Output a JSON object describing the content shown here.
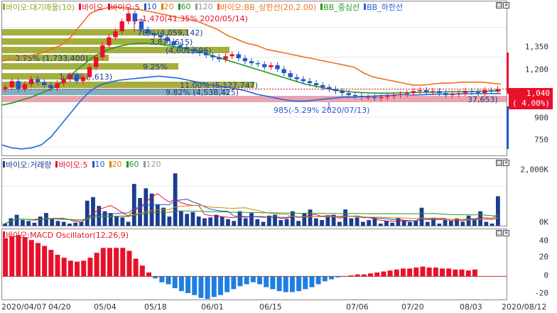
{
  "price_panel": {
    "legend": [
      {
        "label": "바이오:대기매물(10)",
        "color": "#9aa62a"
      },
      {
        "label": "바이오",
        "color": "#e8102a"
      },
      {
        "label": "바이오:5",
        "color": "#e8102a",
        "extra": [
          "10",
          "20",
          "60",
          "120"
        ],
        "extra_colors": [
          "#2255cc",
          "#e08000",
          "#229922",
          "#999999"
        ]
      },
      {
        "label": "바이오:BB_상한선(20,2.00)",
        "color": "#f07020"
      },
      {
        "label": "BB_중심선",
        "color": "#229922"
      },
      {
        "label": "BB_하한선",
        "color": "#2266dd"
      }
    ],
    "axis_ticks": [
      "1,350",
      "1,200",
      "1,040",
      "900",
      "750"
    ],
    "current_price": "1,040",
    "current_change": "( 4.00%)",
    "high_annotation": "1,470(41.35% 2020/05/14)",
    "low_annotation": "985(-5.29% 2020/07/13)",
    "volume_profile": [
      {
        "label": "78% (4,059,142)"
      },
      {
        "label": "3,871,615)"
      },
      {
        "label": "(4,601,696)"
      },
      {
        "label": "3.75% (1,733,400)"
      },
      {
        "label": "9.25%"
      },
      {
        "label": "1.60% (  ,613)"
      },
      {
        "label": "11.00% (5,127,747)"
      },
      {
        "label": "9.82% (4,538,425)"
      },
      {
        "label": "37,653)"
      }
    ]
  },
  "volume_panel": {
    "legend": [
      {
        "label": "바이오:거래량",
        "color": "#1a3d8f"
      },
      {
        "label": "바이오:5",
        "color": "#e8102a",
        "extra": [
          "10",
          "20",
          "60",
          "120"
        ],
        "extra_colors": [
          "#2255cc",
          "#e08000",
          "#229922",
          "#999999"
        ]
      }
    ],
    "axis_ticks": [
      "2,000K",
      "0K"
    ]
  },
  "macd_panel": {
    "legend": [
      {
        "label": "바이오:MACD Oscillator(12,26,9)",
        "color": "#e8102a"
      }
    ],
    "axis_ticks": [
      "40",
      "20",
      "0",
      "-20"
    ]
  },
  "x_axis": {
    "ticks": [
      "2020/04/07",
      "04/20",
      "05/04",
      "05/18",
      "06/01",
      "06/15",
      "07/06",
      "07/20",
      "08/03",
      "2020/08/12"
    ]
  },
  "chart_data": [
    {
      "type": "candlestick",
      "title": "바이오",
      "ylim": [
        700,
        1480
      ],
      "high": {
        "value": 1470,
        "date": "2020/05/14"
      },
      "low": {
        "value": 985,
        "date": "2020/07/13"
      },
      "closes": [
        1050,
        1080,
        1040,
        1065,
        1090,
        1075,
        1060,
        1045,
        1070,
        1090,
        1110,
        1080,
        1100,
        1150,
        1200,
        1260,
        1300,
        1330,
        1380,
        1420,
        1380,
        1340,
        1320,
        1310,
        1300,
        1280,
        1260,
        1250,
        1240,
        1230,
        1220,
        1210,
        1200,
        1190,
        1205,
        1215,
        1195,
        1180,
        1170,
        1165,
        1150,
        1160,
        1140,
        1120,
        1100,
        1090,
        1080,
        1070,
        1060,
        1050,
        1040,
        1030,
        1020,
        1010,
        1005,
        1000,
        1000,
        995,
        1000,
        1005,
        1010,
        1015,
        1020,
        1030,
        1035,
        1025,
        1030,
        1020,
        1010,
        1015,
        1020,
        1030,
        1025,
        1020,
        1035,
        1030,
        1040
      ],
      "series": [
        {
          "name": "BB_상한선",
          "values": [
            1180,
            1190,
            1200,
            1210,
            1220,
            1240,
            1260,
            1300,
            1360,
            1420,
            1440,
            1450,
            1450,
            1445,
            1440,
            1430,
            1420,
            1410,
            1400,
            1390,
            1380,
            1360,
            1340,
            1310,
            1290,
            1270,
            1260,
            1240,
            1230,
            1220,
            1210,
            1200,
            1190,
            1180,
            1170,
            1160,
            1150,
            1120,
            1100,
            1090,
            1080,
            1070,
            1060,
            1060,
            1065,
            1070,
            1070,
            1075,
            1075,
            1075,
            1070,
            1065
          ]
        },
        {
          "name": "BB_중심선",
          "values": [
            960,
            970,
            985,
            1000,
            1020,
            1040,
            1070,
            1110,
            1150,
            1190,
            1220,
            1240,
            1255,
            1265,
            1270,
            1270,
            1265,
            1258,
            1250,
            1240,
            1230,
            1215,
            1200,
            1185,
            1170,
            1155,
            1140,
            1125,
            1110,
            1095,
            1080,
            1065,
            1055,
            1045,
            1035,
            1030,
            1025,
            1022,
            1020,
            1020,
            1020,
            1022,
            1022,
            1024,
            1025,
            1026,
            1027,
            1028,
            1028,
            1029,
            1030,
            1030
          ]
        },
        {
          "name": "BB_하한선",
          "values": [
            760,
            745,
            740,
            745,
            760,
            800,
            860,
            920,
            980,
            1030,
            1060,
            1075,
            1085,
            1090,
            1095,
            1100,
            1105,
            1100,
            1095,
            1085,
            1075,
            1065,
            1055,
            1050,
            1040,
            1030,
            1015,
            1005,
            995,
            985,
            980,
            980,
            985,
            990,
            995,
            1000,
            1000,
            1003,
            1005,
            1008,
            1010,
            1012,
            1010,
            1012,
            1014,
            1015,
            1015,
            1016,
            1017,
            1017,
            1017,
            1018
          ]
        }
      ]
    },
    {
      "type": "bar",
      "title": "바이오:거래량",
      "ylim": [
        0,
        3300
      ],
      "values": [
        200,
        500,
        700,
        400,
        350,
        250,
        600,
        800,
        450,
        350,
        300,
        200,
        250,
        300,
        1500,
        1700,
        1200,
        900,
        800,
        600,
        550,
        300,
        2450,
        1650,
        2200,
        1900,
        1300,
        1100,
        600,
        3050,
        900,
        750,
        850,
        600,
        500,
        550,
        700,
        600,
        450,
        350,
        900,
        500,
        800,
        450,
        300,
        650,
        700,
        400,
        450,
        900,
        350,
        800,
        1000,
        500,
        400,
        600,
        700,
        300,
        1000,
        500,
        550,
        300,
        400,
        500,
        200,
        350,
        250,
        500,
        400,
        300,
        350,
        1100,
        300,
        500,
        200,
        400,
        350,
        500,
        300,
        650,
        450,
        900,
        300,
        200,
        1750
      ]
    },
    {
      "type": "bar",
      "title": "바이오:MACD Oscillator(12,26,9)",
      "ylim": [
        -25,
        48
      ],
      "values": [
        39,
        41,
        42,
        40,
        37,
        34,
        31,
        27,
        22,
        19,
        16,
        15,
        16,
        19,
        24,
        29,
        29,
        29,
        29,
        26,
        18,
        11,
        4,
        -2,
        -6,
        -8,
        -12,
        -15,
        -17,
        -19,
        -22,
        -23,
        -21,
        -19,
        -16,
        -13,
        -10,
        -8,
        -6,
        -8,
        -11,
        -13,
        -15,
        -16,
        -16,
        -15,
        -13,
        -11,
        -8,
        -5,
        -3,
        -1,
        0,
        1,
        2,
        2,
        3,
        4,
        5,
        6,
        7,
        8,
        8,
        9,
        10,
        9,
        9,
        8,
        8,
        7,
        7,
        6,
        7
      ]
    }
  ]
}
